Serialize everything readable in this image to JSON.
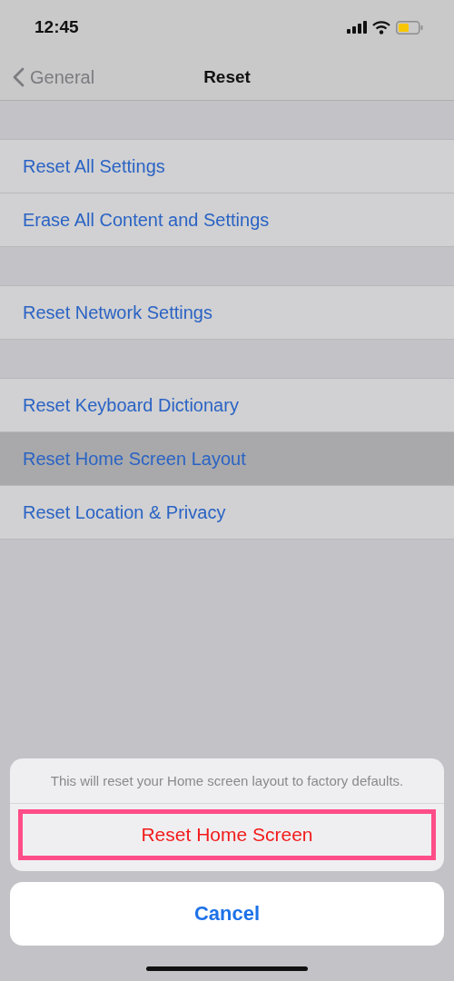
{
  "status_bar": {
    "time": "12:45"
  },
  "nav": {
    "back_label": "General",
    "title": "Reset"
  },
  "groups": [
    {
      "items": [
        {
          "label": "Reset All Settings",
          "selected": false
        },
        {
          "label": "Erase All Content and Settings",
          "selected": false
        }
      ]
    },
    {
      "items": [
        {
          "label": "Reset Network Settings",
          "selected": false
        }
      ]
    },
    {
      "items": [
        {
          "label": "Reset Keyboard Dictionary",
          "selected": false
        },
        {
          "label": "Reset Home Screen Layout",
          "selected": true
        },
        {
          "label": "Reset Location & Privacy",
          "selected": false
        }
      ]
    }
  ],
  "action_sheet": {
    "message": "This will reset your Home screen layout to factory defaults.",
    "action": {
      "label": "Reset Home Screen",
      "highlighted": true
    },
    "cancel": "Cancel"
  }
}
